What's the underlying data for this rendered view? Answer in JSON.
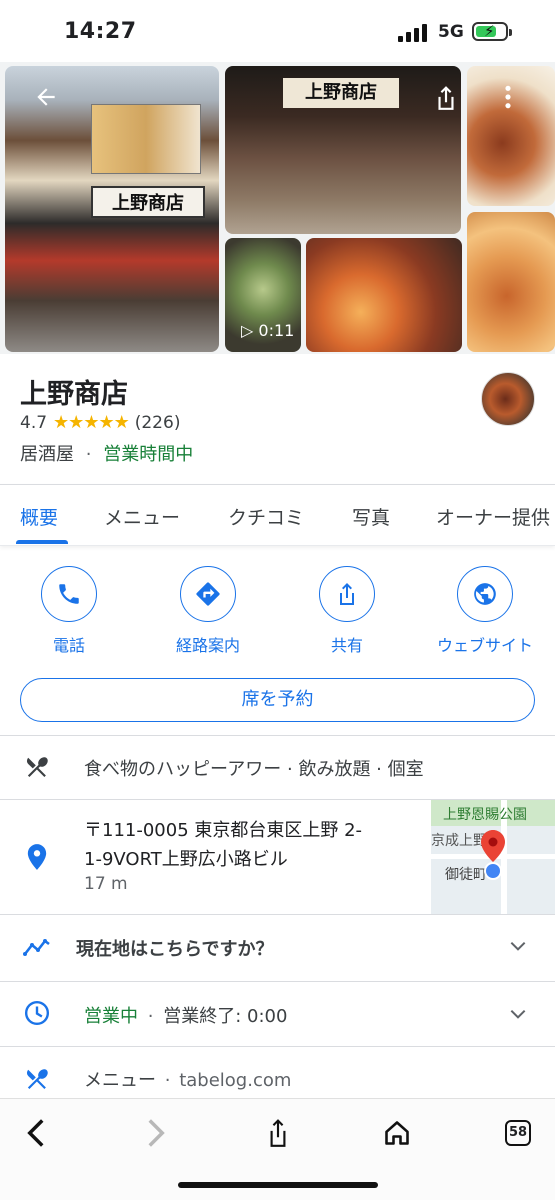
{
  "status_bar": {
    "time": "14:27",
    "network": "5G",
    "battery_charging": true
  },
  "photos": {
    "sign_text": "上野商店",
    "video_duration": "0:11"
  },
  "place": {
    "name": "上野商店",
    "rating": "4.7",
    "stars_display": "★★★★★",
    "review_count": "(226)",
    "category": "居酒屋",
    "separator": "·",
    "open_status": "営業時間中"
  },
  "tabs": [
    {
      "label": "概要",
      "active": true
    },
    {
      "label": "メニュー",
      "active": false
    },
    {
      "label": "クチコミ",
      "active": false
    },
    {
      "label": "写真",
      "active": false
    },
    {
      "label": "オーナー提供",
      "active": false
    }
  ],
  "actions": {
    "call": "電話",
    "directions": "経路案内",
    "share": "共有",
    "website": "ウェブサイト"
  },
  "reserve_label": "席を予約",
  "amenities": "食べ物のハッピーアワー · 飲み放題 · 個室",
  "address": {
    "line1": "〒111-0005 東京都台東区上野 2-",
    "line2": "1-9VORT上野広小路ビル",
    "distance": "17 m"
  },
  "map": {
    "label_park": "上野恩賜公園",
    "label_station": "京成上野",
    "label_area": "御徒町"
  },
  "location_prompt": "現在地はこちらですか？",
  "hours": {
    "status": "営業中",
    "separator": "·",
    "close": "営業終了: 0:00"
  },
  "menu_link": {
    "label": "メニュー",
    "separator": "·",
    "source": "tabelog.com"
  },
  "browser": {
    "tab_count": "58"
  },
  "colors": {
    "accent": "#1a73e8",
    "open_green": "#188038",
    "star": "#f5b400"
  }
}
